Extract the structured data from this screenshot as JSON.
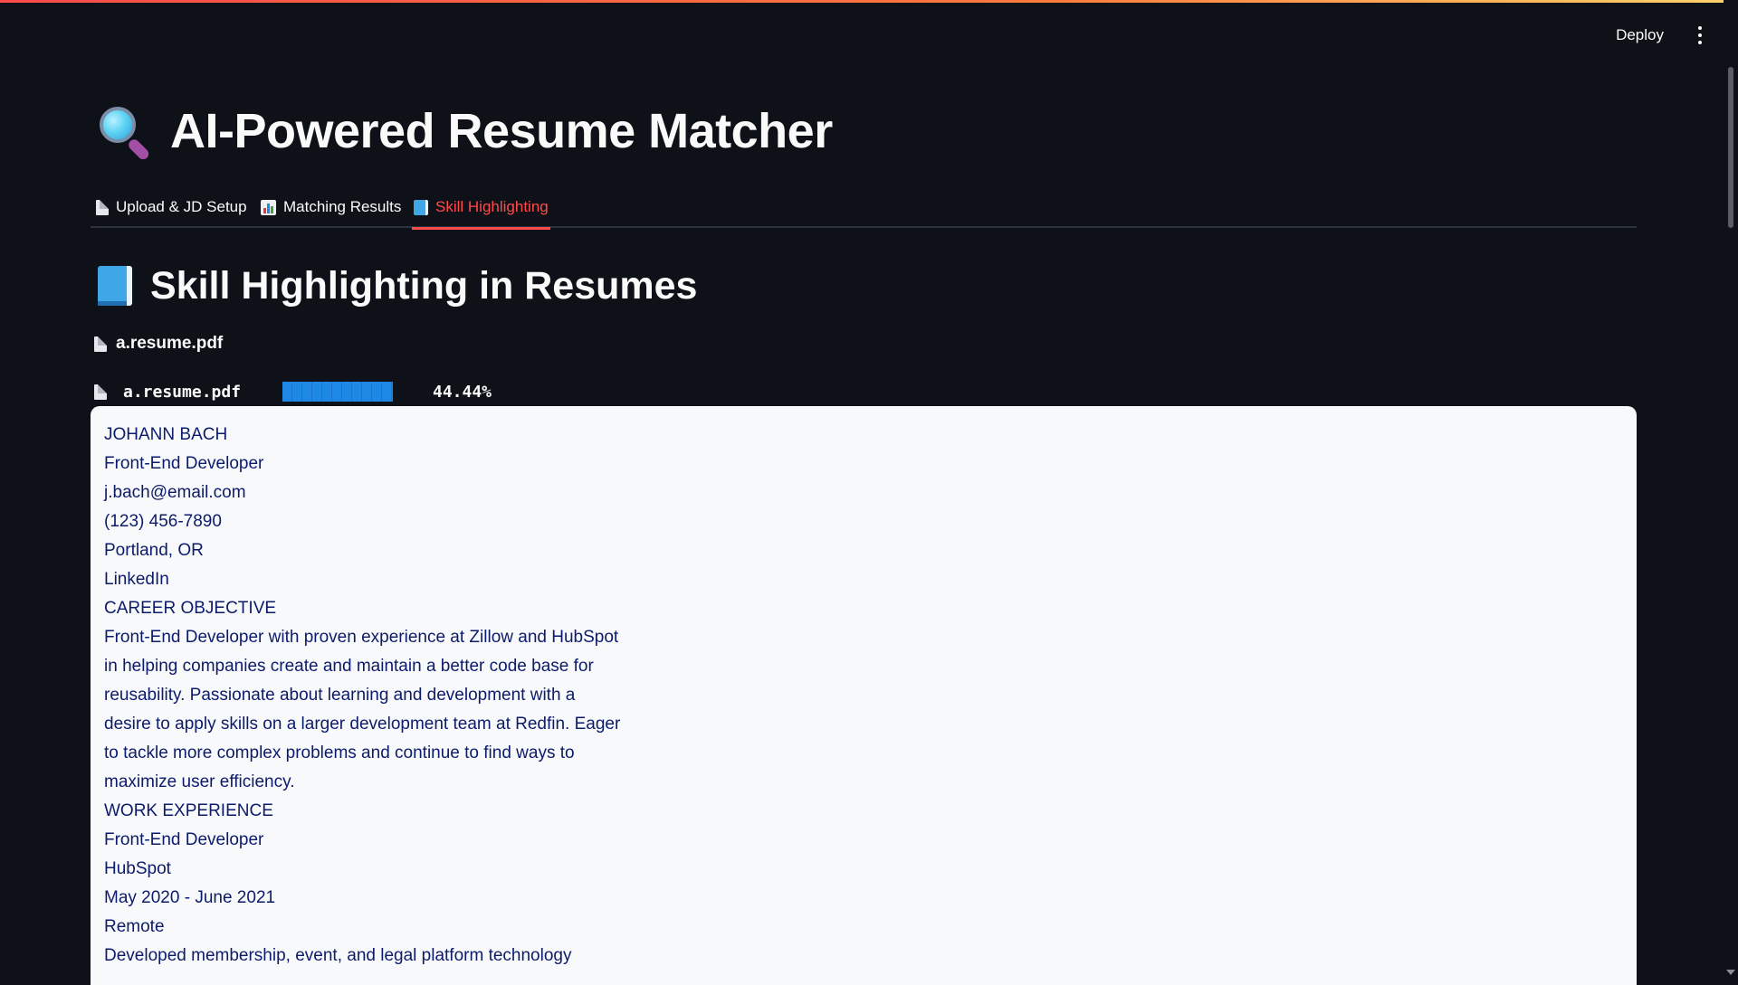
{
  "header": {
    "deploy_label": "Deploy",
    "menu_icon": "more-vertical-icon"
  },
  "app": {
    "title": "AI-Powered Resume Matcher",
    "title_icon": "magnifying-glass-icon"
  },
  "tabs": [
    {
      "label": "Upload & JD Setup",
      "icon": "page-icon",
      "active": false
    },
    {
      "label": "Matching Results",
      "icon": "bar-chart-icon",
      "active": false
    },
    {
      "label": "Skill Highlighting",
      "icon": "blue-book-icon",
      "active": true
    }
  ],
  "section": {
    "title": "Skill Highlighting in Resumes",
    "icon": "blue-book-icon"
  },
  "file": {
    "name": "a.resume.pdf",
    "score_filename": "a.resume.pdf",
    "score_percent": "44.44%",
    "score_value": 44.44
  },
  "resume": {
    "lines": [
      "JOHANN BACH",
      "Front-End Developer",
      "j.bach@email.com",
      "(123) 456-7890",
      "Portland, OR",
      "LinkedIn",
      "CAREER OBJECTIVE",
      "Front-End Developer with proven experience at Zillow and HubSpot",
      "in helping companies create and maintain a better code base for",
      "reusability. Passionate about learning and development with a",
      "desire to apply skills on a larger development team at Redfin. Eager",
      "to tackle more complex problems and continue to find ways to",
      "maximize user efficiency.",
      "WORK EXPERIENCE",
      "Front-End Developer",
      "HubSpot",
      "May 2020 - June 2021",
      "Remote",
      "Developed membership, event, and legal platform technology"
    ]
  },
  "colors": {
    "background": "#0e1117",
    "accent": "#ff4b4b",
    "resume_text": "#0d1b6b",
    "score_bar": "#1e88e5"
  }
}
